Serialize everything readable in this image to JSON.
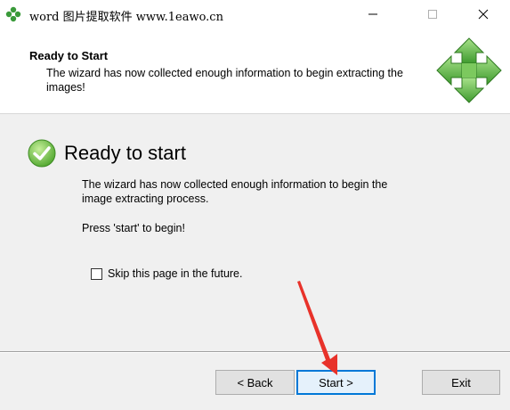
{
  "window": {
    "title": "word 图片提取软件  www.1eawo.cn",
    "controls": {
      "minimize": "minimize",
      "maximize": "maximize",
      "close": "close"
    }
  },
  "header": {
    "title": "Ready to Start",
    "description": "The wizard has now collected enough information to begin extracting the images!"
  },
  "content": {
    "title": "Ready to start",
    "body": "The wizard has now collected enough information to begin the image extracting process.",
    "press": "Press 'start' to begin!",
    "skip_label": "Skip this page in the future.",
    "skip_checked": false
  },
  "buttons": {
    "back": "< Back",
    "start": "Start >",
    "exit": "Exit"
  },
  "colors": {
    "accent": "#0078d7",
    "check_green": "#5fb63a",
    "annotation_red": "#e8322a"
  }
}
